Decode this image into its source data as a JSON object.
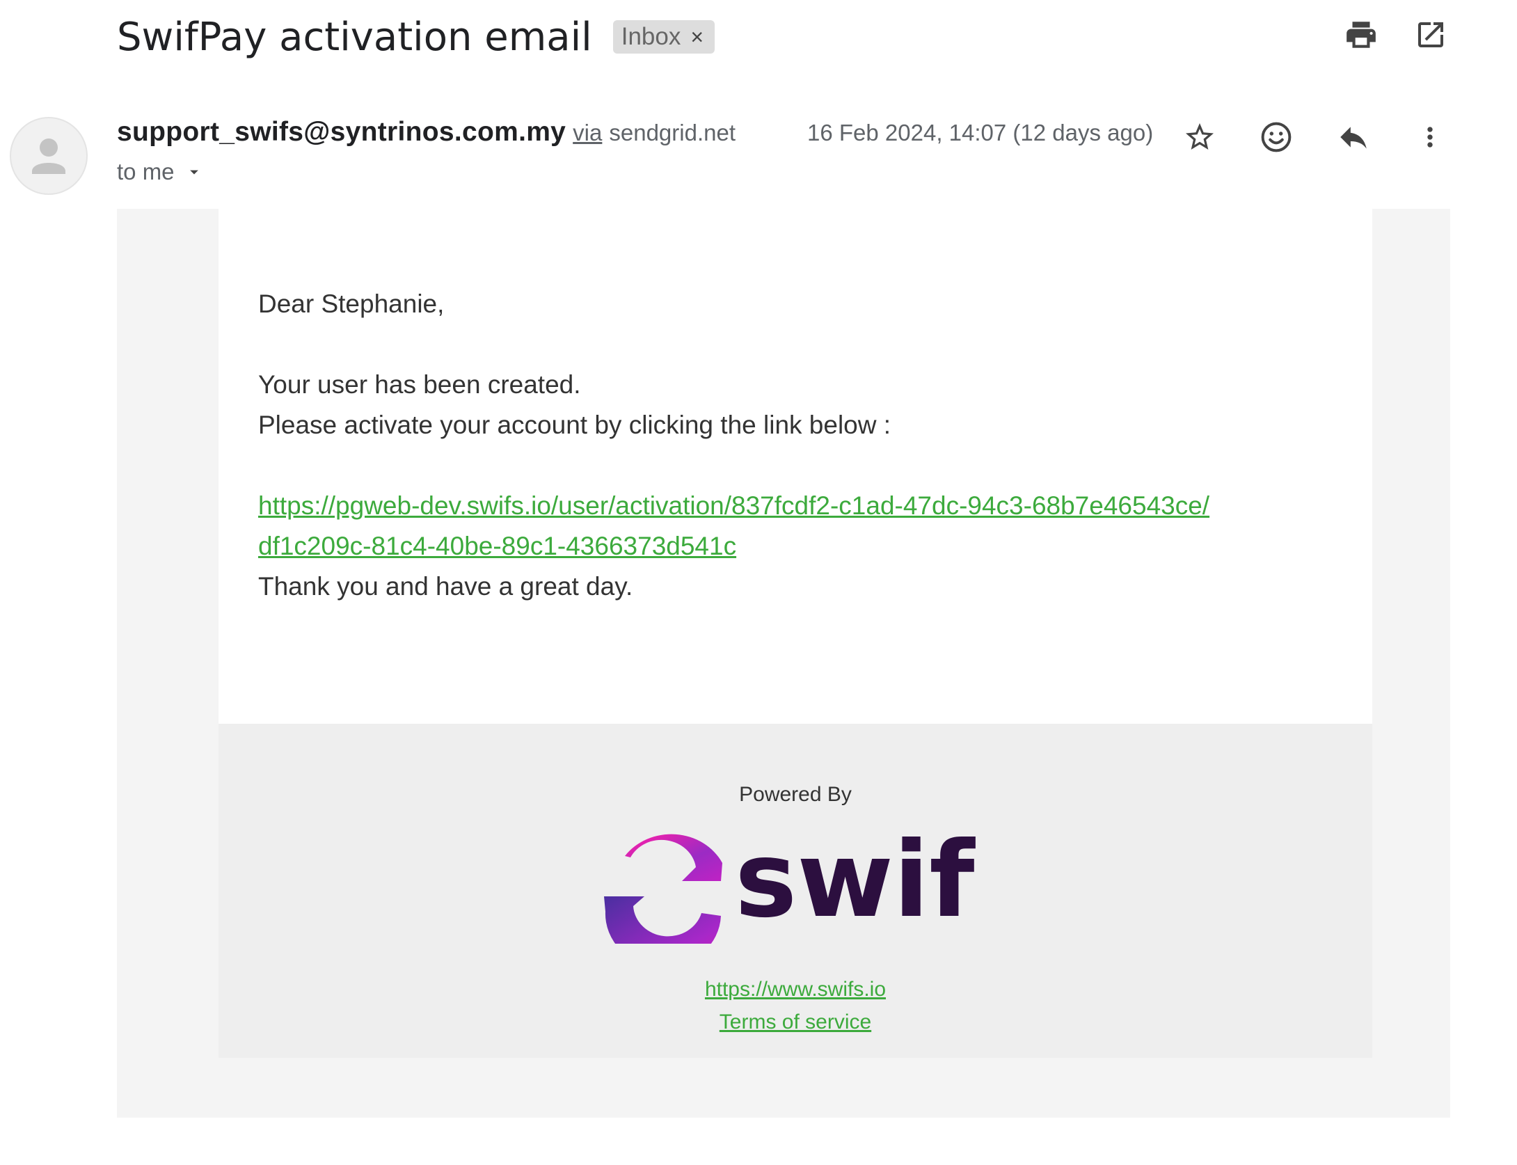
{
  "email": {
    "subject": "SwifPay activation email",
    "label_chip": "Inbox",
    "label_remove": "×",
    "sender_email": "support_swifs@syntrinos.com.my",
    "via_word": "via",
    "via_domain": "sendgrid.net",
    "date": "16 Feb 2024, 14:07 (12 days ago)",
    "recipient": "to me"
  },
  "body": {
    "greeting": "Dear Stephanie,",
    "line1": "Your user has been created.",
    "line2": "Please activate your account by clicking the link below :",
    "link_part1": "https://pgweb-dev.swifs.io/user/activation/837fcdf2-c1ad-47dc-94c3-68b7e46543ce/",
    "link_part2": "df1c209c-81c4-40be-89c1-4366373d541c",
    "closing": "Thank you and have a great day."
  },
  "footer": {
    "powered_by": "Powered By",
    "brand": "swif",
    "website": "https://www.swifs.io",
    "terms": "Terms of service"
  },
  "icons": [
    "print-icon",
    "open-in-new-window-icon",
    "person-icon",
    "star-icon",
    "emoji-icon",
    "reply-icon",
    "more-vert-icon",
    "dropdown-arrow-icon"
  ],
  "colors": {
    "link": "#3caa3c",
    "brand_dark": "#2c0f3f",
    "brand_magenta": "#e020b0",
    "brand_purple": "#6a2fb8"
  }
}
